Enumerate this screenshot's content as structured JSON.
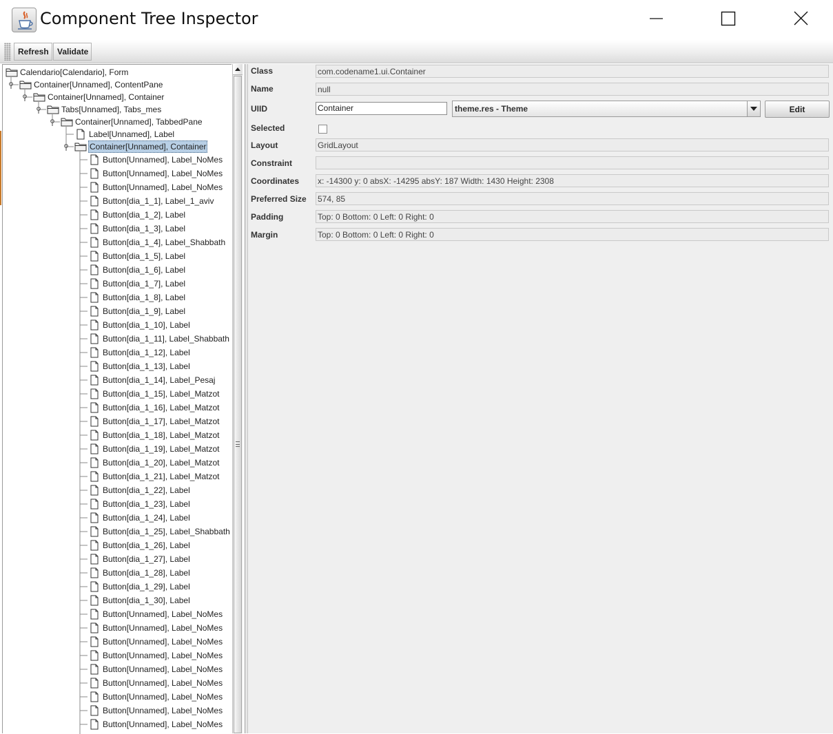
{
  "window": {
    "title": "Component Tree Inspector"
  },
  "toolbar": {
    "refresh_label": "Refresh",
    "validate_label": "Validate"
  },
  "tree": {
    "nodes": [
      {
        "label": "Calendario[Calendario], Form",
        "type": "folder",
        "depth": 0,
        "expanded": true
      },
      {
        "label": "Container[Unnamed], ContentPane",
        "type": "folder",
        "depth": 1,
        "expanded": true
      },
      {
        "label": "Container[Unnamed], Container",
        "type": "folder",
        "depth": 2,
        "expanded": true
      },
      {
        "label": "Tabs[Unnamed], Tabs_mes",
        "type": "folder",
        "depth": 3,
        "expanded": true
      },
      {
        "label": "Container[Unnamed], TabbedPane",
        "type": "folder",
        "depth": 4,
        "expanded": true
      },
      {
        "label": "Label[Unnamed], Label",
        "type": "file",
        "depth": 5
      },
      {
        "label": "Container[Unnamed], Container",
        "type": "folder",
        "depth": 5,
        "expanded": true,
        "selected": true
      },
      {
        "label": "Button[Unnamed], Label_NoMes",
        "type": "file",
        "depth": 6
      },
      {
        "label": "Button[Unnamed], Label_NoMes",
        "type": "file",
        "depth": 6
      },
      {
        "label": "Button[Unnamed], Label_NoMes",
        "type": "file",
        "depth": 6
      },
      {
        "label": "Button[dia_1_1], Label_1_aviv",
        "type": "file",
        "depth": 6
      },
      {
        "label": "Button[dia_1_2], Label",
        "type": "file",
        "depth": 6
      },
      {
        "label": "Button[dia_1_3], Label",
        "type": "file",
        "depth": 6
      },
      {
        "label": "Button[dia_1_4], Label_Shabbath",
        "type": "file",
        "depth": 6
      },
      {
        "label": "Button[dia_1_5], Label",
        "type": "file",
        "depth": 6
      },
      {
        "label": "Button[dia_1_6], Label",
        "type": "file",
        "depth": 6
      },
      {
        "label": "Button[dia_1_7], Label",
        "type": "file",
        "depth": 6
      },
      {
        "label": "Button[dia_1_8], Label",
        "type": "file",
        "depth": 6
      },
      {
        "label": "Button[dia_1_9], Label",
        "type": "file",
        "depth": 6
      },
      {
        "label": "Button[dia_1_10], Label",
        "type": "file",
        "depth": 6
      },
      {
        "label": "Button[dia_1_11], Label_Shabbath",
        "type": "file",
        "depth": 6
      },
      {
        "label": "Button[dia_1_12], Label",
        "type": "file",
        "depth": 6
      },
      {
        "label": "Button[dia_1_13], Label",
        "type": "file",
        "depth": 6
      },
      {
        "label": "Button[dia_1_14], Label_Pesaj",
        "type": "file",
        "depth": 6
      },
      {
        "label": "Button[dia_1_15], Label_Matzot",
        "type": "file",
        "depth": 6
      },
      {
        "label": "Button[dia_1_16], Label_Matzot",
        "type": "file",
        "depth": 6
      },
      {
        "label": "Button[dia_1_17], Label_Matzot",
        "type": "file",
        "depth": 6
      },
      {
        "label": "Button[dia_1_18], Label_Matzot",
        "type": "file",
        "depth": 6
      },
      {
        "label": "Button[dia_1_19], Label_Matzot",
        "type": "file",
        "depth": 6
      },
      {
        "label": "Button[dia_1_20], Label_Matzot",
        "type": "file",
        "depth": 6
      },
      {
        "label": "Button[dia_1_21], Label_Matzot",
        "type": "file",
        "depth": 6
      },
      {
        "label": "Button[dia_1_22], Label",
        "type": "file",
        "depth": 6
      },
      {
        "label": "Button[dia_1_23], Label",
        "type": "file",
        "depth": 6
      },
      {
        "label": "Button[dia_1_24], Label",
        "type": "file",
        "depth": 6
      },
      {
        "label": "Button[dia_1_25], Label_Shabbath",
        "type": "file",
        "depth": 6
      },
      {
        "label": "Button[dia_1_26], Label",
        "type": "file",
        "depth": 6
      },
      {
        "label": "Button[dia_1_27], Label",
        "type": "file",
        "depth": 6
      },
      {
        "label": "Button[dia_1_28], Label",
        "type": "file",
        "depth": 6
      },
      {
        "label": "Button[dia_1_29], Label",
        "type": "file",
        "depth": 6
      },
      {
        "label": "Button[dia_1_30], Label",
        "type": "file",
        "depth": 6
      },
      {
        "label": "Button[Unnamed], Label_NoMes",
        "type": "file",
        "depth": 6
      },
      {
        "label": "Button[Unnamed], Label_NoMes",
        "type": "file",
        "depth": 6
      },
      {
        "label": "Button[Unnamed], Label_NoMes",
        "type": "file",
        "depth": 6
      },
      {
        "label": "Button[Unnamed], Label_NoMes",
        "type": "file",
        "depth": 6
      },
      {
        "label": "Button[Unnamed], Label_NoMes",
        "type": "file",
        "depth": 6
      },
      {
        "label": "Button[Unnamed], Label_NoMes",
        "type": "file",
        "depth": 6
      },
      {
        "label": "Button[Unnamed], Label_NoMes",
        "type": "file",
        "depth": 6
      },
      {
        "label": "Button[Unnamed], Label_NoMes",
        "type": "file",
        "depth": 6
      },
      {
        "label": "Button[Unnamed], Label_NoMes",
        "type": "file",
        "depth": 6
      }
    ]
  },
  "properties": {
    "class_label": "Class",
    "class_value": "com.codename1.ui.Container",
    "name_label": "Name",
    "name_value": "null",
    "uiid_label": "UIID",
    "uiid_value": "Container",
    "theme_selected": "theme.res - Theme",
    "edit_label": "Edit",
    "selected_label": "Selected",
    "selected_checked": false,
    "layout_label": "Layout",
    "layout_value": "GridLayout",
    "constraint_label": "Constraint",
    "constraint_value": "",
    "coordinates_label": "Coordinates",
    "coordinates_value": "x: -14300 y: 0 absX: -14295 absY: 187 Width: 1430 Height: 2308",
    "preferred_size_label": "Preferred Size",
    "preferred_size_value": "574, 85",
    "padding_label": "Padding",
    "padding_value": "Top: 0 Bottom: 0 Left: 0 Right: 0",
    "margin_label": "Margin",
    "margin_value": "Top: 0 Bottom: 0 Left: 0 Right: 0"
  },
  "icons": {
    "app": "java-cup-icon",
    "minimize": "minimize-icon",
    "maximize": "maximize-icon",
    "close": "close-icon",
    "folder": "folder-icon",
    "file": "file-icon",
    "dropdown": "chevron-down-icon"
  },
  "colors": {
    "selection_bg": "#b8cfe5",
    "panel_bg": "#efefef"
  }
}
